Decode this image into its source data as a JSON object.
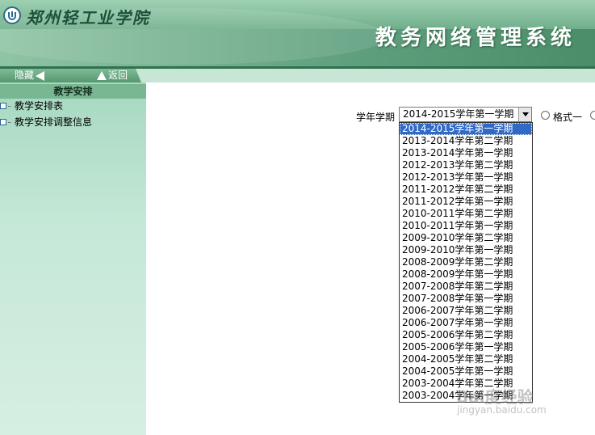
{
  "header": {
    "school_name": "郑州轻工业学院",
    "system_title": "教务网络管理系统"
  },
  "nav": {
    "hide_label": "隐藏",
    "back_label": "返回"
  },
  "sidebar": {
    "section_title": "教学安排",
    "items": [
      {
        "label": "教学安排表"
      },
      {
        "label": "教学安排调整信息"
      }
    ]
  },
  "form": {
    "term_label": "学年学期",
    "selected_term": "2014-2015学年第一学期",
    "format_option_1": "格式一",
    "options": [
      "2014-2015学年第一学期",
      "2013-2014学年第二学期",
      "2013-2014学年第一学期",
      "2012-2013学年第二学期",
      "2012-2013学年第一学期",
      "2011-2012学年第二学期",
      "2011-2012学年第一学期",
      "2010-2011学年第二学期",
      "2010-2011学年第一学期",
      "2009-2010学年第二学期",
      "2009-2010学年第一学期",
      "2008-2009学年第二学期",
      "2008-2009学年第一学期",
      "2007-2008学年第二学期",
      "2007-2008学年第一学期",
      "2006-2007学年第二学期",
      "2006-2007学年第一学期",
      "2005-2006学年第二学期",
      "2005-2006学年第一学期",
      "2004-2005学年第二学期",
      "2004-2005学年第一学期",
      "2003-2004学年第二学期",
      "2003-2004学年第一学期"
    ]
  },
  "watermark": {
    "text": "Bai度经验",
    "url": "jingyan.baidu.com"
  },
  "colors": {
    "header_green": "#5e9f7d",
    "sidebar_green": "#c5e8d7",
    "selection_blue": "#3169c6"
  }
}
